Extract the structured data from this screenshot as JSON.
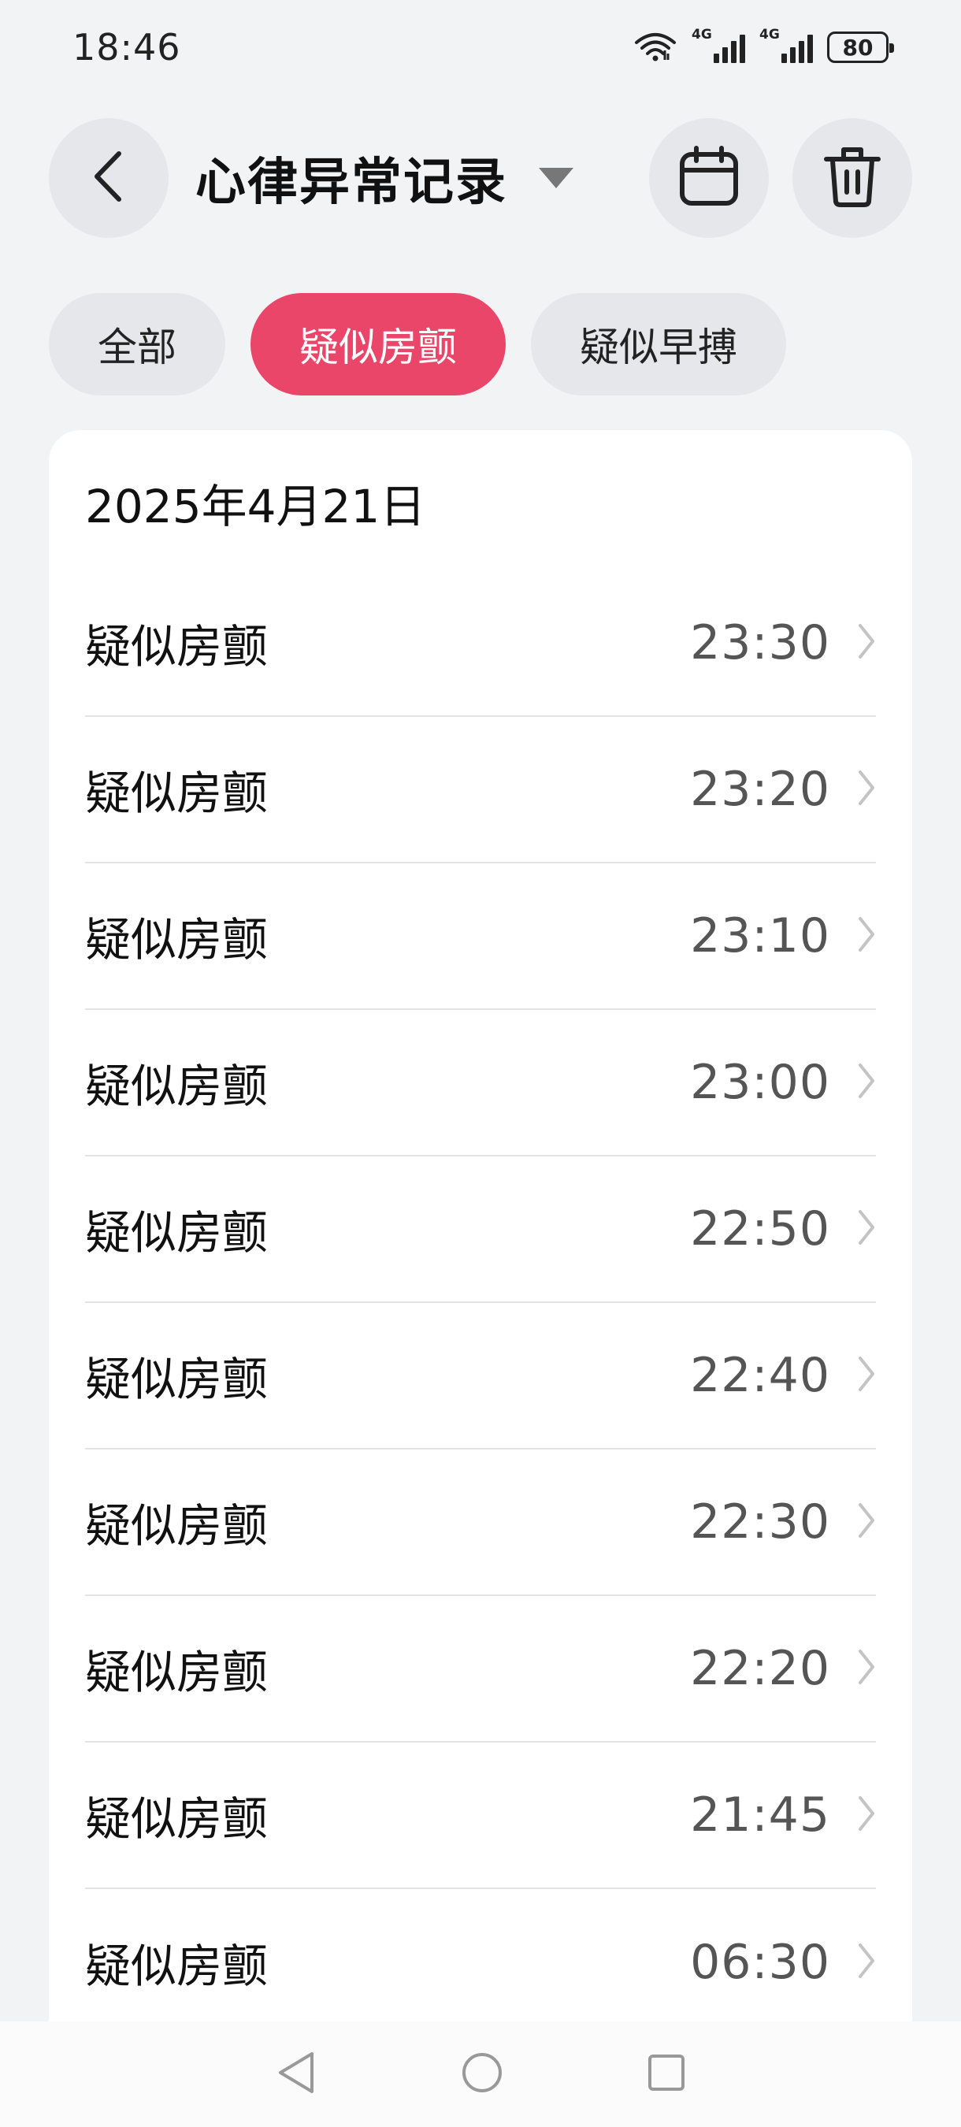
{
  "status_bar": {
    "time": "18:46",
    "network_1": "4G",
    "network_2": "4G",
    "battery": "80"
  },
  "header": {
    "title": "心律异常记录"
  },
  "filters": [
    {
      "label": "全部",
      "active": false
    },
    {
      "label": "疑似房颤",
      "active": true
    },
    {
      "label": "疑似早搏",
      "active": false
    }
  ],
  "date_heading": "2025年4月21日",
  "records": [
    {
      "label": "疑似房颤",
      "time": "23:30"
    },
    {
      "label": "疑似房颤",
      "time": "23:20"
    },
    {
      "label": "疑似房颤",
      "time": "23:10"
    },
    {
      "label": "疑似房颤",
      "time": "23:00"
    },
    {
      "label": "疑似房颤",
      "time": "22:50"
    },
    {
      "label": "疑似房颤",
      "time": "22:40"
    },
    {
      "label": "疑似房颤",
      "time": "22:30"
    },
    {
      "label": "疑似房颤",
      "time": "22:20"
    },
    {
      "label": "疑似房颤",
      "time": "21:45"
    },
    {
      "label": "疑似房颤",
      "time": "06:30"
    }
  ],
  "colors": {
    "accent": "#e94669",
    "background": "#f1f3f5",
    "chip": "#e5e7ea"
  },
  "icons": [
    "back-arrow-icon",
    "caret-down-icon",
    "calendar-icon",
    "trash-icon",
    "chevron-right-icon",
    "wifi-icon",
    "signal-icon",
    "battery-icon",
    "nav-back-icon",
    "nav-home-icon",
    "nav-recents-icon"
  ]
}
